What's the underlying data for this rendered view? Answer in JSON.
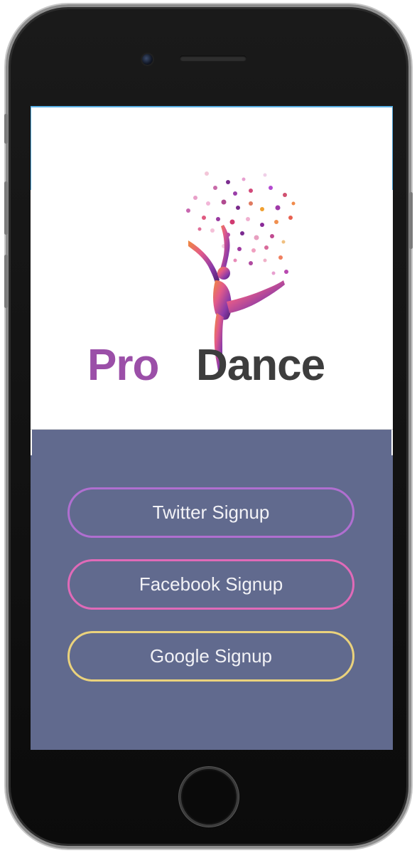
{
  "app": {
    "brand_part1": "Pro",
    "brand_part2": "Dance"
  },
  "colors": {
    "brand_purple": "#9b4fa8",
    "brand_dark": "#3d3d3d",
    "panel_background": "#616a8e",
    "twitter_border": "#b06fd0",
    "facebook_border": "#e06ab8",
    "google_border": "#ead27c"
  },
  "buttons": [
    {
      "label": "Twitter Signup",
      "border_color": "#b06fd0"
    },
    {
      "label": "Facebook Signup",
      "border_color": "#e06ab8"
    },
    {
      "label": "Google Signup",
      "border_color": "#ead27c"
    }
  ],
  "icons": {
    "logo": "dancer-silhouette-icon",
    "camera": "front-camera-icon",
    "home": "home-button-icon"
  }
}
